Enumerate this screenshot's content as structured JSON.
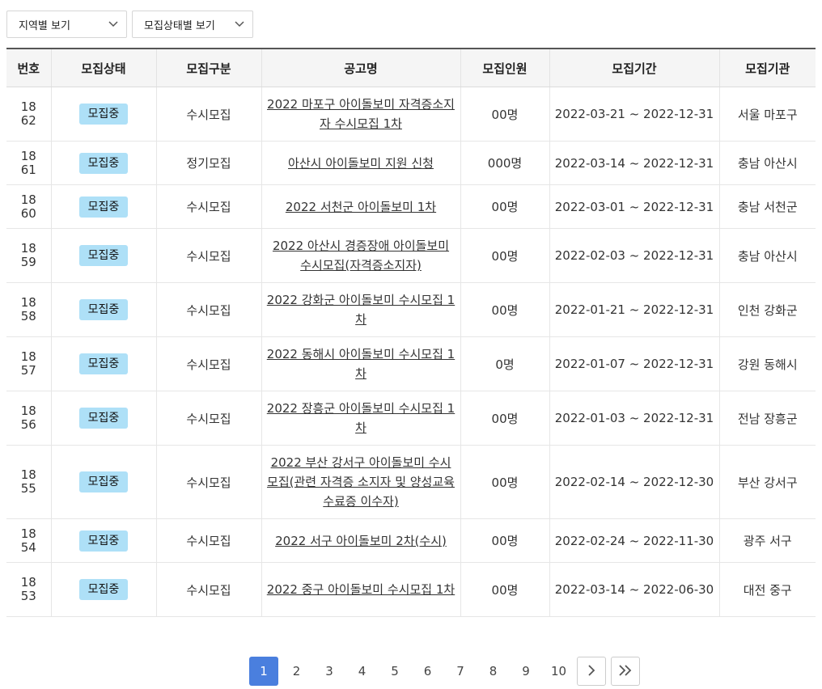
{
  "filters": {
    "region": "지역별 보기",
    "status": "모집상태별 보기"
  },
  "table": {
    "headers": [
      "번호",
      "모집상태",
      "모집구분",
      "공고명",
      "모집인원",
      "모집기간",
      "모집기관"
    ],
    "rows": [
      {
        "no": "1862",
        "status": "모집중",
        "type": "수시모집",
        "title": "2022 마포구 아이돌보미 자격증소지자 수시모집 1차",
        "count": "00명",
        "period": "2022-03-21 ~ 2022-12-31",
        "agency": "서울 마포구"
      },
      {
        "no": "1861",
        "status": "모집중",
        "type": "정기모집",
        "title": "아산시 아이돌보미 지원 신청",
        "count": "000명",
        "period": "2022-03-14 ~ 2022-12-31",
        "agency": "충남 아산시"
      },
      {
        "no": "1860",
        "status": "모집중",
        "type": "수시모집",
        "title": "2022 서천군 아이돌보미 1차",
        "count": "00명",
        "period": "2022-03-01 ~ 2022-12-31",
        "agency": "충남 서천군"
      },
      {
        "no": "1859",
        "status": "모집중",
        "type": "수시모집",
        "title": "2022 아산시 경증장애 아이돌보미 수시모집(자격증소지자)",
        "count": "00명",
        "period": "2022-02-03 ~ 2022-12-31",
        "agency": "충남 아산시"
      },
      {
        "no": "1858",
        "status": "모집중",
        "type": "수시모집",
        "title": "2022 강화군 아이돌보미 수시모집 1차",
        "count": "00명",
        "period": "2022-01-21 ~ 2022-12-31",
        "agency": "인천 강화군"
      },
      {
        "no": "1857",
        "status": "모집중",
        "type": "수시모집",
        "title": "2022 동해시 아이돌보미 수시모집 1차",
        "count": "0명",
        "period": "2022-01-07 ~ 2022-12-31",
        "agency": "강원 동해시"
      },
      {
        "no": "1856",
        "status": "모집중",
        "type": "수시모집",
        "title": "2022 장흥군 아이돌보미 수시모집 1차",
        "count": "00명",
        "period": "2022-01-03 ~ 2022-12-31",
        "agency": "전남 장흥군"
      },
      {
        "no": "1855",
        "status": "모집중",
        "type": "수시모집",
        "title": "2022 부산 강서구 아이돌보미 수시모집(관련 자격증 소지자 및 양성교육 수료증 이수자)",
        "count": "00명",
        "period": "2022-02-14 ~ 2022-12-30",
        "agency": "부산 강서구"
      },
      {
        "no": "1854",
        "status": "모집중",
        "type": "수시모집",
        "title": "2022 서구 아이돌보미 2차(수시)",
        "count": "00명",
        "period": "2022-02-24 ~ 2022-11-30",
        "agency": "광주 서구"
      },
      {
        "no": "1853",
        "status": "모집중",
        "type": "수시모집",
        "title": "2022 중구 아이돌보미 수시모집 1차",
        "count": "00명",
        "period": "2022-03-14 ~ 2022-06-30",
        "agency": "대전 중구"
      }
    ]
  },
  "pagination": {
    "pages": [
      "1",
      "2",
      "3",
      "4",
      "5",
      "6",
      "7",
      "8",
      "9",
      "10"
    ],
    "current": "1",
    "next_icon": "chevron-right-icon",
    "last_icon": "double-chevron-right-icon"
  },
  "colors": {
    "badge": "#aee0f7",
    "active_page": "#4a7fde"
  }
}
